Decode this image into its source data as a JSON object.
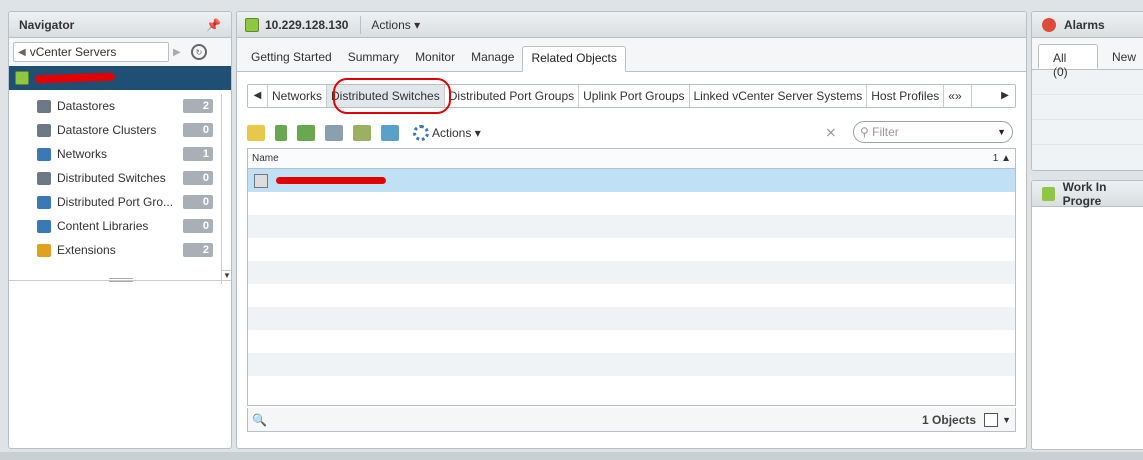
{
  "navigator": {
    "title": "Navigator",
    "breadcrumb": "vCenter Servers",
    "items": [
      {
        "label": "Datastores",
        "count": "2",
        "icon": "datastore-icon",
        "color": "#6d7a85"
      },
      {
        "label": "Datastore Clusters",
        "count": "0",
        "icon": "datastore-cluster-icon",
        "color": "#6d7a85"
      },
      {
        "label": "Networks",
        "count": "1",
        "icon": "network-icon",
        "color": "#3a78b8"
      },
      {
        "label": "Distributed Switches",
        "count": "0",
        "icon": "distributed-switch-icon",
        "color": "#6d7a85"
      },
      {
        "label": "Distributed Port Gro...",
        "count": "0",
        "icon": "distributed-port-group-icon",
        "color": "#3a78b8"
      },
      {
        "label": "Content Libraries",
        "count": "0",
        "icon": "content-library-icon",
        "color": "#3a78b8"
      },
      {
        "label": "Extensions",
        "count": "2",
        "icon": "extensions-icon",
        "color": "#e0a020"
      }
    ]
  },
  "main": {
    "title": "10.229.128.130",
    "actions": "Actions",
    "tabs": [
      "Getting Started",
      "Summary",
      "Monitor",
      "Manage",
      "Related Objects"
    ],
    "subtabs": [
      "Networks",
      "Distributed Switches",
      "Distributed Port Groups",
      "Uplink Port Groups",
      "Linked vCenter Server Systems",
      "Host Profiles"
    ],
    "toolbar_actions": "Actions",
    "filter_placeholder": "Filter",
    "grid": {
      "column": "Name",
      "sort": "1 ▲",
      "objects": "1 Objects"
    }
  },
  "alarms": {
    "title": "Alarms",
    "tabs": [
      "All (0)",
      "New"
    ]
  },
  "work_in_progress": {
    "title": "Work In Progre"
  }
}
